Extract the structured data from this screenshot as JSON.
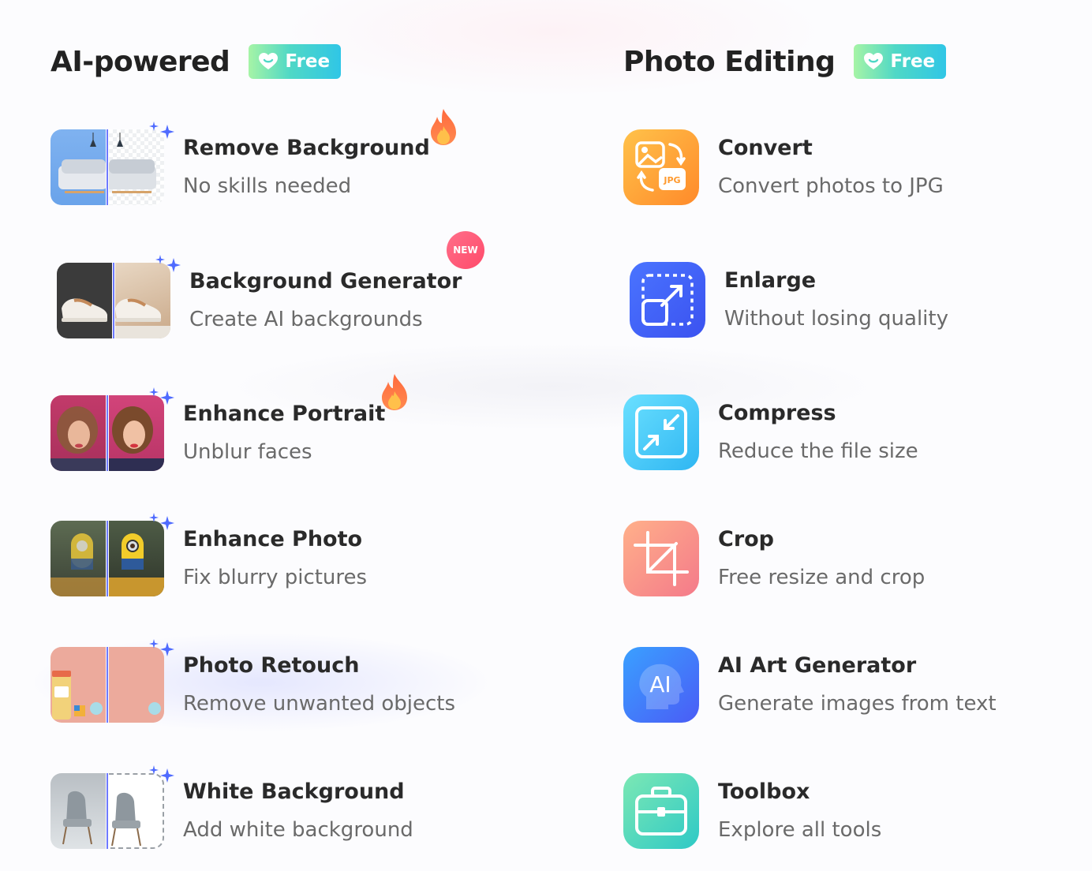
{
  "left": {
    "title": "AI-powered",
    "badge": "Free",
    "tools": [
      {
        "name": "Remove Background",
        "desc": "No skills needed",
        "marker": "hot"
      },
      {
        "name": "Background Generator",
        "desc": "Create AI backgrounds",
        "marker": "new",
        "marker_text": "NEW"
      },
      {
        "name": "Enhance Portrait",
        "desc": "Unblur faces",
        "marker": "hot"
      },
      {
        "name": "Enhance Photo",
        "desc": "Fix blurry pictures"
      },
      {
        "name": "Photo Retouch",
        "desc": "Remove unwanted objects"
      },
      {
        "name": "White Background",
        "desc": "Add white background"
      }
    ]
  },
  "right": {
    "title": "Photo Editing",
    "badge": "Free",
    "tools": [
      {
        "name": "Convert",
        "desc": "Convert photos to JPG",
        "icon": "convert-icon",
        "icon_text": "JPG"
      },
      {
        "name": "Enlarge",
        "desc": "Without losing quality",
        "icon": "enlarge-icon"
      },
      {
        "name": "Compress",
        "desc": "Reduce the file size",
        "icon": "compress-icon"
      },
      {
        "name": "Crop",
        "desc": "Free resize and crop",
        "icon": "crop-icon"
      },
      {
        "name": "AI Art Generator",
        "desc": "Generate images from text",
        "icon": "ai-art-icon",
        "icon_text": "AI"
      },
      {
        "name": "Toolbox",
        "desc": "Explore all tools",
        "icon": "toolbox-icon"
      }
    ]
  },
  "colors": {
    "free_badge": "#4fd8c6",
    "divider": "#6d79ff",
    "sparkle": "#4f6bff",
    "new_badge": "#ff4a6a"
  }
}
